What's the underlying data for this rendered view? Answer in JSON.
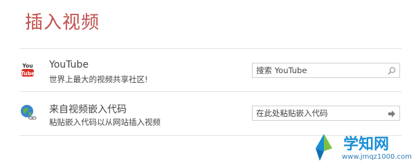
{
  "dialog": {
    "title": "插入视频"
  },
  "youtube": {
    "title": "YouTube",
    "subtitle": "世界上最大的视频共享社区!",
    "icon_text": "You Tube",
    "search_placeholder": "搜索 YouTube"
  },
  "embed": {
    "title": "来自视频嵌入代码",
    "subtitle": "粘贴嵌入代码以从网站插入视频",
    "placeholder": "在此处粘贴嵌入代码"
  },
  "watermark": {
    "text": "学知网",
    "url": "www.jmqz1000.com"
  },
  "colors": {
    "title": "#c0504d",
    "youtube_red": "#d92c25",
    "watermark_blue": "#1a8fd6"
  }
}
